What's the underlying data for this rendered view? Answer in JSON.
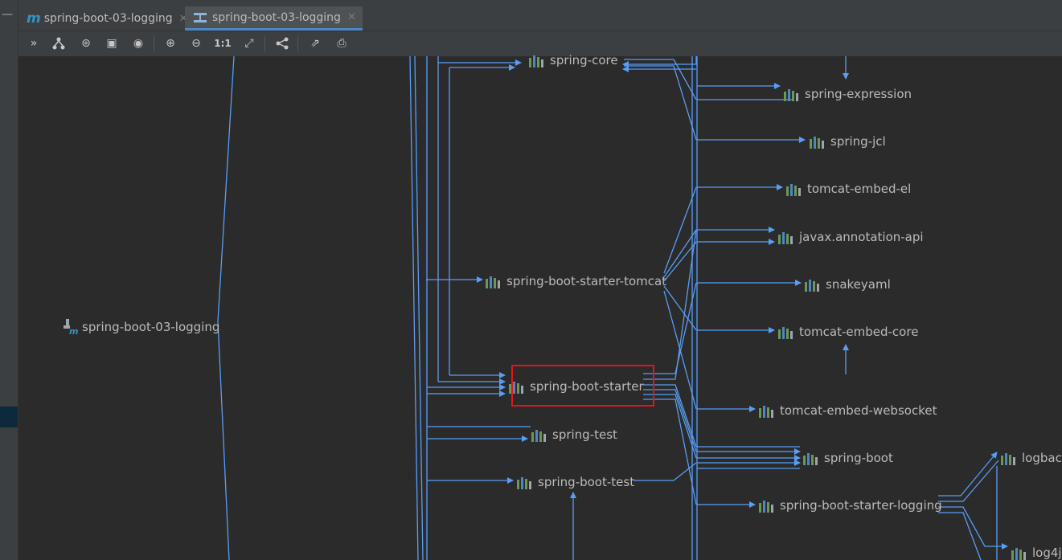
{
  "tabs": [
    {
      "label": "spring-boot-03-logging",
      "icon": "maven-m-icon"
    },
    {
      "label": "spring-boot-03-logging",
      "icon": "diagram-icon"
    }
  ],
  "toolbar": {
    "icons": [
      "collapse-icon",
      "layout-icon",
      "focus-icon",
      "fit-icon",
      "visibility-icon",
      "zoom-in-icon",
      "zoom-out-icon",
      "actual-size-icon",
      "fit-content-icon",
      "dependencies-icon",
      "export-icon",
      "print-icon"
    ],
    "actual_size_label": "1:1"
  },
  "graph": {
    "root": "spring-boot-03-logging",
    "nodes": {
      "spring_core": "spring-core",
      "spring_expression": "spring-expression",
      "spring_jcl": "spring-jcl",
      "tomcat_embed_el": "tomcat-embed-el",
      "javax_annotation_api": "javax.annotation-api",
      "spring_boot_starter_tomcat": "spring-boot-starter-tomcat",
      "snakeyaml": "snakeyaml",
      "tomcat_embed_core": "tomcat-embed-core",
      "spring_boot_starter": "spring-boot-starter",
      "tomcat_embed_websocket": "tomcat-embed-websocket",
      "spring_test": "spring-test",
      "spring_boot": "spring-boot",
      "logback": "logbac",
      "spring_boot_test": "spring-boot-test",
      "spring_boot_starter_logging": "spring-boot-starter-logging",
      "log4j": "log4j"
    },
    "highlighted": "spring-boot-starter",
    "colors": {
      "edge": "#589df6",
      "highlight": "#e0161b",
      "bar_green": "#6a9955",
      "bar_blue": "#4a88c7"
    }
  }
}
